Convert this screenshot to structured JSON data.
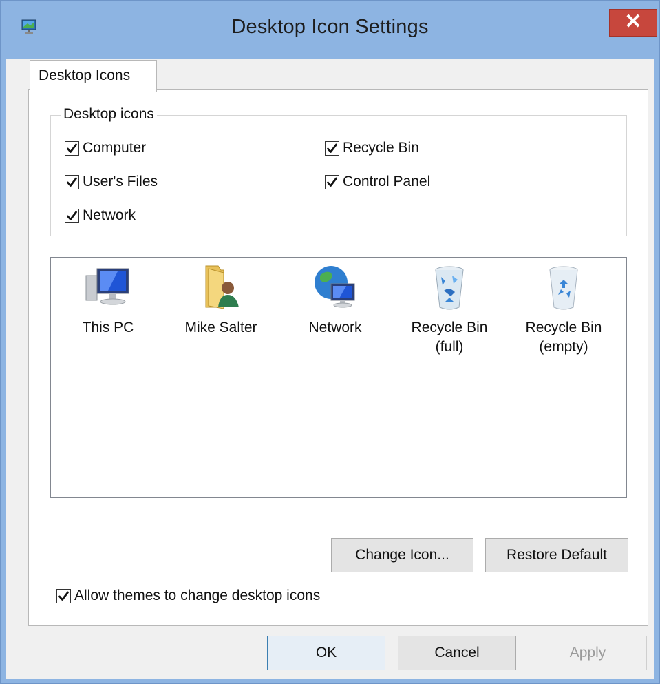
{
  "window": {
    "title": "Desktop Icon Settings",
    "close_glyph": "✕"
  },
  "tabs": [
    {
      "label": "Desktop Icons",
      "selected": true
    }
  ],
  "desktop_icons_group": {
    "legend": "Desktop icons",
    "checkboxes": [
      {
        "label": "Computer",
        "checked": true
      },
      {
        "label": "Recycle Bin",
        "checked": true
      },
      {
        "label": "User's Files",
        "checked": true
      },
      {
        "label": "Control Panel",
        "checked": true
      },
      {
        "label": "Network",
        "checked": true
      }
    ]
  },
  "icon_list": {
    "items": [
      {
        "label": "This PC",
        "icon": "computer-icon"
      },
      {
        "label": "Mike Salter",
        "icon": "user-folder-icon"
      },
      {
        "label": "Network",
        "icon": "network-globe-icon"
      },
      {
        "label": "Recycle Bin\n(full)",
        "icon": "recycle-bin-full-icon"
      },
      {
        "label": "Recycle Bin\n(empty)",
        "icon": "recycle-bin-empty-icon"
      }
    ]
  },
  "icon_buttons": {
    "change_icon": "Change Icon...",
    "restore_default": "Restore Default"
  },
  "allow_themes": {
    "label": "Allow themes to change desktop icons",
    "checked": true
  },
  "footer_buttons": {
    "ok": "OK",
    "cancel": "Cancel",
    "apply": "Apply",
    "apply_enabled": false
  },
  "colors": {
    "title_bar": "#8db4e2",
    "close_button": "#c7473d"
  }
}
